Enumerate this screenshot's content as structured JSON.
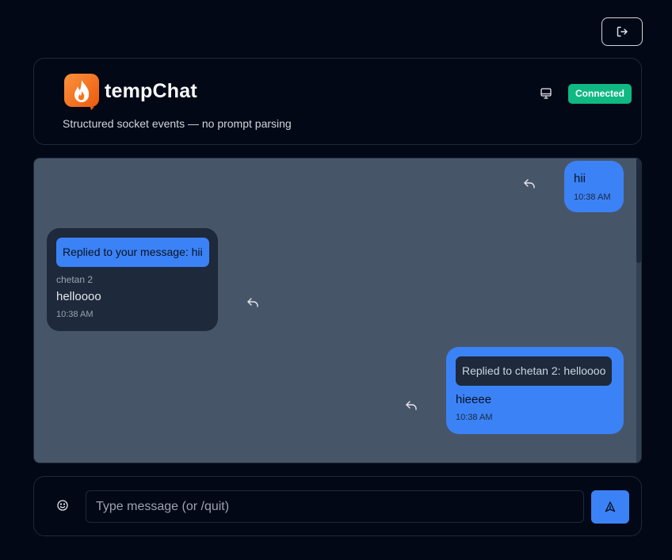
{
  "header": {
    "app_title": "tempChat",
    "subtitle": "Structured socket events — no prompt parsing",
    "status": "Connected",
    "logo_icon": "flame-chat-icon",
    "status_color": "#10b981"
  },
  "messages": [
    {
      "own": true,
      "text": "hii",
      "time": "10:38 AM"
    },
    {
      "own": false,
      "reply_to": "Replied to your message: hii",
      "sender": "chetan 2",
      "text": "helloooo",
      "time": "10:38 AM"
    },
    {
      "own": true,
      "reply_to": "Replied to chetan 2: helloooo",
      "text": "hieeee",
      "time": "10:38 AM"
    }
  ],
  "composer": {
    "placeholder": "Type message (or /quit)",
    "value": ""
  },
  "colors": {
    "accent": "#3b82f6",
    "background": "#030817",
    "chat_background": "#475569",
    "bubble_other": "#1e293b"
  }
}
